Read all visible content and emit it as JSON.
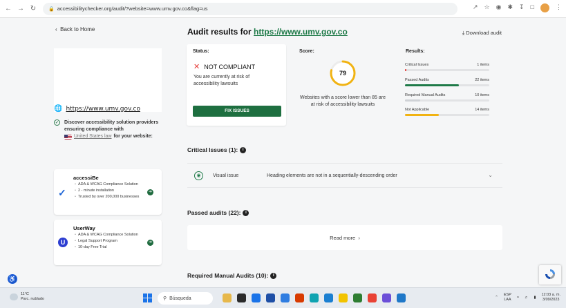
{
  "browser": {
    "url": "accessibilitychecker.org/audit/?website=www.umv.gov.co&flag=us"
  },
  "sidebar": {
    "back_label": "Back to Home",
    "site_url": "https://www.umv.gov.co",
    "discover_text": "Discover accessibility solution providers ensuring compliance with",
    "law_link": "United States law",
    "law_suffix": "for your website:",
    "vendors": [
      {
        "name": "accessiBe",
        "features": [
          "ADA & WCAG Compliance Solution",
          "2 - minute installation",
          "Trusted by over 200,000 businesses"
        ]
      },
      {
        "name": "UserWay",
        "features": [
          "ADA & WCAG Compliance Solution",
          "Legal Support Program",
          "10-day Free Trial"
        ]
      }
    ]
  },
  "main": {
    "title_prefix": "Audit results for",
    "title_url": "https://www.umv.gov.co",
    "download_label": "Download audit",
    "status": {
      "heading": "Status:",
      "verdict": "NOT COMPLIANT",
      "risk_text": "You are currently at risk of accessibility lawsuits",
      "fix_button": "FIX ISSUES"
    },
    "score": {
      "heading": "Score:",
      "value": "79",
      "value_num": 79,
      "note": "Websites with a score lower than 85 are at risk of accessibility lawsuits"
    },
    "results": {
      "heading": "Results:",
      "rows": [
        {
          "label": "Critical Issues",
          "value": "1 items",
          "fraction": 0.02,
          "color": "#e53935"
        },
        {
          "label": "Passed Audits",
          "value": "22 items",
          "fraction": 0.64,
          "color": "#1e7a48"
        },
        {
          "label": "Required Manual Audits",
          "value": "10 items",
          "fraction": 0.18,
          "color": "#cfd2d6"
        },
        {
          "label": "Not Applicable",
          "value": "14 items",
          "fraction": 0.4,
          "color": "#f1b312"
        }
      ]
    },
    "critical": {
      "heading": "Critical Issues (1):",
      "issue_type": "Visual issue",
      "issue_desc": "Heading elements are not in a sequentially-descending order"
    },
    "passed": {
      "heading": "Passed audits (22):",
      "read_more": "Read more"
    },
    "manual": {
      "heading": "Required Manual Audits (10):"
    }
  },
  "taskbar": {
    "temp": "11°C",
    "weather": "Parc. nublado",
    "search_label": "Búsqueda",
    "lang_top": "ESP",
    "lang_bottom": "LAA",
    "time": "12:03 a. m.",
    "date": "3/09/2023"
  },
  "colors": {
    "brand_green": "#1e7a48",
    "score_ring": "#f1b312",
    "critical_red": "#e53935"
  }
}
